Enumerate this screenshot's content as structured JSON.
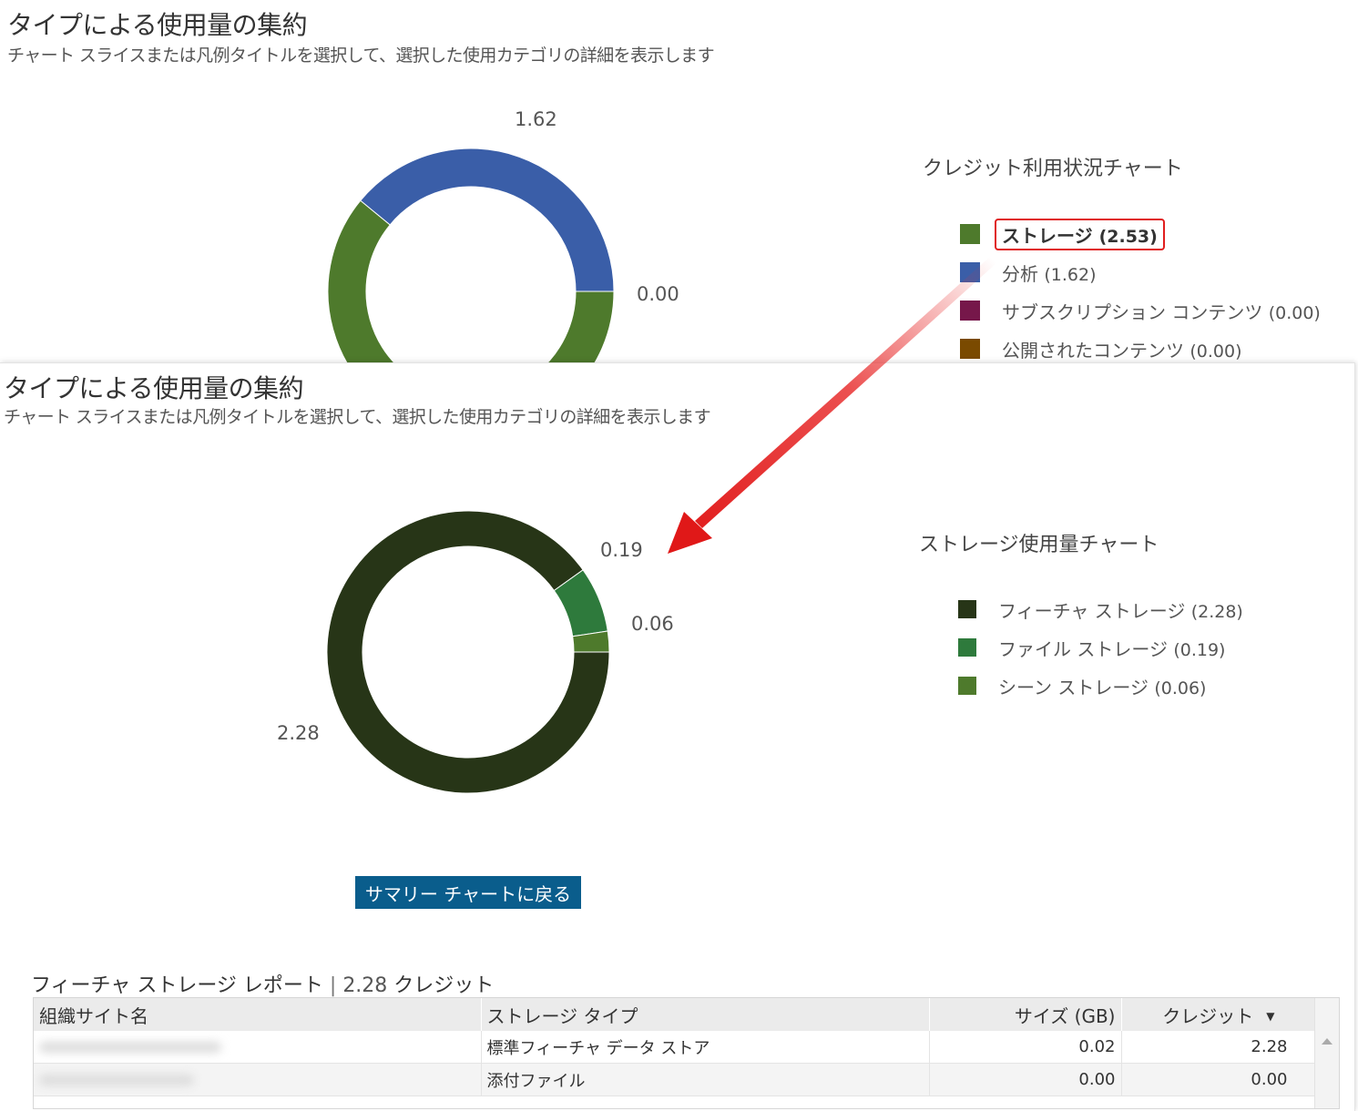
{
  "summary": {
    "title": "タイプによる使用量の集約",
    "subtitle": "チャート スライスまたは凡例タイトルを選択して、選択した使用カテゴリの詳細を表示します",
    "legend_title": "クレジット利用状況チャート",
    "legend": [
      {
        "label": "ストレージ",
        "value": "(2.53)",
        "color": "#4e7a2c",
        "selected": true
      },
      {
        "label": "分析",
        "value": "(1.62)",
        "color": "#3a5ea8"
      },
      {
        "label": "サブスクリプション コンテンツ",
        "value": "(0.00)",
        "color": "#76174a"
      },
      {
        "label": "公開されたコンテンツ",
        "value": "(0.00)",
        "color": "#7a4a00"
      }
    ],
    "slice_labels": {
      "analysis": "1.62",
      "zero": "0.00"
    }
  },
  "detail": {
    "title": "タイプによる使用量の集約",
    "subtitle": "チャート スライスまたは凡例タイトルを選択して、選択した使用カテゴリの詳細を表示します",
    "legend_title": "ストレージ使用量チャート",
    "legend": [
      {
        "label": "フィーチャ ストレージ",
        "value": "(2.28)",
        "color": "#273517"
      },
      {
        "label": "ファイル ストレージ",
        "value": "(0.19)",
        "color": "#2e7a3c"
      },
      {
        "label": "シーン ストレージ",
        "value": "(0.06)",
        "color": "#4e7a2c"
      }
    ],
    "slice_labels": {
      "feature": "2.28",
      "file": "0.19",
      "scene": "0.06"
    },
    "back_button": "サマリー チャートに戻る",
    "report": {
      "name": "フィーチャ ストレージ レポート",
      "separator": "|",
      "amount": "2.28",
      "unit": "クレジット"
    },
    "table": {
      "columns": [
        "組織サイト名",
        "ストレージ タイプ",
        "サイズ (GB)",
        "クレジット"
      ],
      "rows": [
        {
          "site": "",
          "type": "標準フィーチャ データ ストア",
          "size": "0.02",
          "credits": "2.28"
        },
        {
          "site": "",
          "type": "添付ファイル",
          "size": "0.00",
          "credits": "0.00"
        }
      ]
    }
  },
  "chart_data": [
    {
      "type": "pie",
      "title": "クレジット利用状況チャート",
      "categories": [
        "ストレージ",
        "分析",
        "サブスクリプション コンテンツ",
        "公開されたコンテンツ"
      ],
      "values": [
        2.53,
        1.62,
        0.0,
        0.0
      ],
      "colors": [
        "#4e7a2c",
        "#3a5ea8",
        "#76174a",
        "#7a4a00"
      ],
      "legend": "right"
    },
    {
      "type": "pie",
      "title": "ストレージ使用量チャート",
      "categories": [
        "フィーチャ ストレージ",
        "ファイル ストレージ",
        "シーン ストレージ"
      ],
      "values": [
        2.28,
        0.19,
        0.06
      ],
      "colors": [
        "#273517",
        "#2e7a3c",
        "#4e7a2c"
      ],
      "legend": "right"
    }
  ]
}
